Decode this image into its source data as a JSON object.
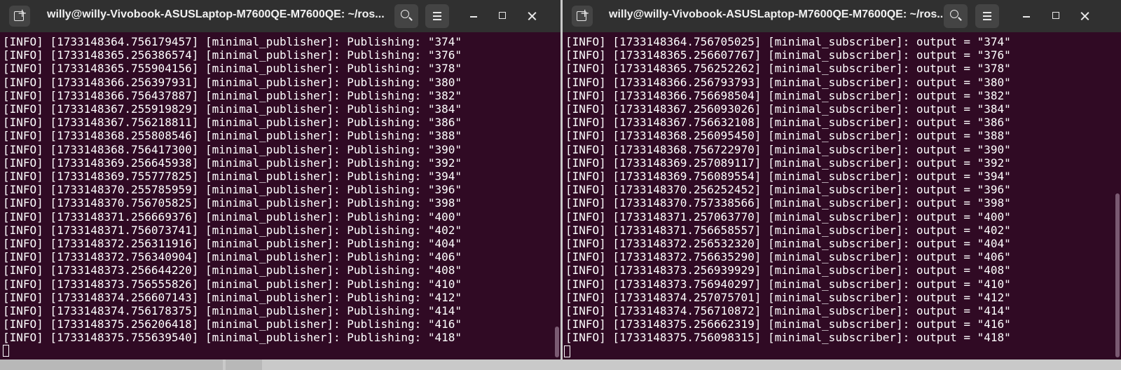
{
  "left_terminal": {
    "title": "willy@willy-Vivobook-ASUSLaptop-M7600QE-M7600QE: ~/ros...",
    "lines": [
      "[INFO] [1733148364.756179457] [minimal_publisher]: Publishing: \"374\"",
      "[INFO] [1733148365.256386574] [minimal_publisher]: Publishing: \"376\"",
      "[INFO] [1733148365.755904156] [minimal_publisher]: Publishing: \"378\"",
      "[INFO] [1733148366.256397931] [minimal_publisher]: Publishing: \"380\"",
      "[INFO] [1733148366.756437887] [minimal_publisher]: Publishing: \"382\"",
      "[INFO] [1733148367.255919829] [minimal_publisher]: Publishing: \"384\"",
      "[INFO] [1733148367.756218811] [minimal_publisher]: Publishing: \"386\"",
      "[INFO] [1733148368.255808546] [minimal_publisher]: Publishing: \"388\"",
      "[INFO] [1733148368.756417300] [minimal_publisher]: Publishing: \"390\"",
      "[INFO] [1733148369.256645938] [minimal_publisher]: Publishing: \"392\"",
      "[INFO] [1733148369.755777825] [minimal_publisher]: Publishing: \"394\"",
      "[INFO] [1733148370.255785959] [minimal_publisher]: Publishing: \"396\"",
      "[INFO] [1733148370.756705825] [minimal_publisher]: Publishing: \"398\"",
      "[INFO] [1733148371.256669376] [minimal_publisher]: Publishing: \"400\"",
      "[INFO] [1733148371.756073741] [minimal_publisher]: Publishing: \"402\"",
      "[INFO] [1733148372.256311916] [minimal_publisher]: Publishing: \"404\"",
      "[INFO] [1733148372.756340904] [minimal_publisher]: Publishing: \"406\"",
      "[INFO] [1733148373.256644220] [minimal_publisher]: Publishing: \"408\"",
      "[INFO] [1733148373.756555826] [minimal_publisher]: Publishing: \"410\"",
      "[INFO] [1733148374.256607143] [minimal_publisher]: Publishing: \"412\"",
      "[INFO] [1733148374.756178375] [minimal_publisher]: Publishing: \"414\"",
      "[INFO] [1733148375.256206418] [minimal_publisher]: Publishing: \"416\"",
      "[INFO] [1733148375.755639540] [minimal_publisher]: Publishing: \"418\""
    ]
  },
  "right_terminal": {
    "title": "willy@willy-Vivobook-ASUSLaptop-M7600QE-M7600QE: ~/ros...",
    "lines": [
      "[INFO] [1733148364.756705025] [minimal_subscriber]: output = \"374\"",
      "[INFO] [1733148365.256607767] [minimal_subscriber]: output = \"376\"",
      "[INFO] [1733148365.756252262] [minimal_subscriber]: output = \"378\"",
      "[INFO] [1733148366.256793793] [minimal_subscriber]: output = \"380\"",
      "[INFO] [1733148366.756698504] [minimal_subscriber]: output = \"382\"",
      "[INFO] [1733148367.256093026] [minimal_subscriber]: output = \"384\"",
      "[INFO] [1733148367.756632108] [minimal_subscriber]: output = \"386\"",
      "[INFO] [1733148368.256095450] [minimal_subscriber]: output = \"388\"",
      "[INFO] [1733148368.756722970] [minimal_subscriber]: output = \"390\"",
      "[INFO] [1733148369.257089117] [minimal_subscriber]: output = \"392\"",
      "[INFO] [1733148369.756089554] [minimal_subscriber]: output = \"394\"",
      "[INFO] [1733148370.256252452] [minimal_subscriber]: output = \"396\"",
      "[INFO] [1733148370.757338566] [minimal_subscriber]: output = \"398\"",
      "[INFO] [1733148371.257063770] [minimal_subscriber]: output = \"400\"",
      "[INFO] [1733148371.756658557] [minimal_subscriber]: output = \"402\"",
      "[INFO] [1733148372.256532320] [minimal_subscriber]: output = \"404\"",
      "[INFO] [1733148372.756635290] [minimal_subscriber]: output = \"406\"",
      "[INFO] [1733148373.256939929] [minimal_subscriber]: output = \"408\"",
      "[INFO] [1733148373.756940297] [minimal_subscriber]: output = \"410\"",
      "[INFO] [1733148374.257075701] [minimal_subscriber]: output = \"412\"",
      "[INFO] [1733148374.756710872] [minimal_subscriber]: output = \"414\"",
      "[INFO] [1733148375.256662319] [minimal_subscriber]: output = \"416\"",
      "[INFO] [1733148375.756098315] [minimal_subscriber]: output = \"418\""
    ]
  },
  "icons": {
    "new_tab": "new-tab-icon",
    "search": "search-icon",
    "menu": "hamburger-menu-icon",
    "minimize": "minimize-icon",
    "maximize": "maximize-icon",
    "close": "close-icon"
  },
  "colors": {
    "terminal_bg": "#300a24",
    "titlebar_bg": "#303030",
    "text": "#ffffff"
  }
}
